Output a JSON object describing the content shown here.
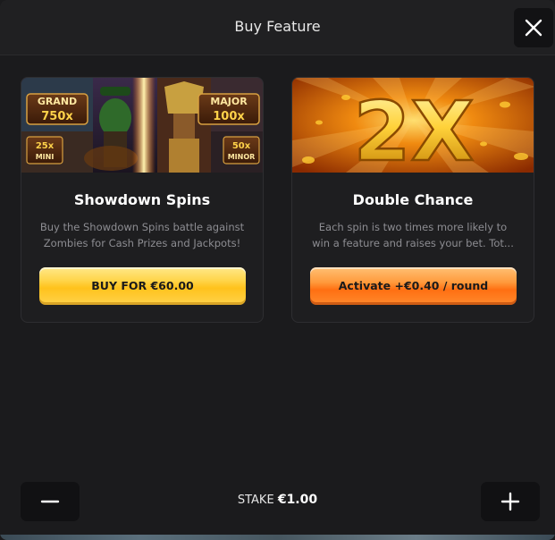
{
  "header": {
    "title": "Buy Feature",
    "close_icon": "close-icon"
  },
  "cards": [
    {
      "title": "Showdown Spins",
      "description_line1": "Buy the Showdown Spins battle against",
      "description_line2": "Zombies for Cash Prizes and Jackpots!",
      "button_label": "BUY FOR €60.00",
      "banner": {
        "jackpot_grand_label": "GRAND",
        "jackpot_grand_value": "750x",
        "jackpot_major_label": "MAJOR",
        "jackpot_major_value": "100x",
        "jackpot_mini_value": "25x",
        "jackpot_mini_label": "MINI",
        "jackpot_minor_value": "50x",
        "jackpot_minor_label": "MINOR"
      }
    },
    {
      "title": "Double Chance",
      "description_line1": "Each spin is two times more likely to",
      "description_line2": "win a feature and raises your bet. Tot...",
      "button_label": "Activate +€0.40 / round",
      "banner": {
        "multiplier_text": "2X"
      }
    }
  ],
  "footer": {
    "stake_label": "STAKE",
    "stake_value": "€1.00",
    "minus_icon": "minus-icon",
    "plus_icon": "plus-icon"
  },
  "colors": {
    "background": "#1b1b1d",
    "header": "#202022",
    "card": "#1e1e20",
    "button_yellow": "#ffc21c",
    "button_orange": "#ff6f12",
    "description_text": "#8d8d92"
  }
}
